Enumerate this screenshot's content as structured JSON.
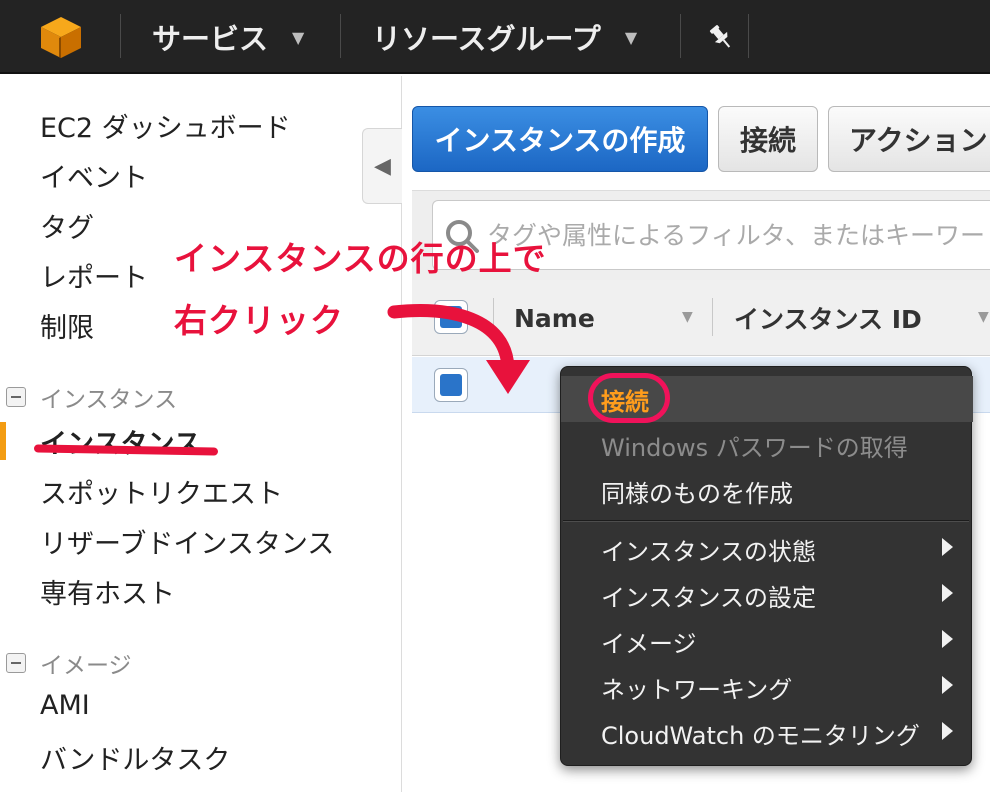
{
  "topbar": {
    "logo_icon": "aws-cube-icon",
    "services_label": "サービス",
    "resource_groups_label": "リソースグループ",
    "pin_icon": "pushpin-icon"
  },
  "sidebar": {
    "top_items": [
      {
        "label": "EC2 ダッシュボード"
      },
      {
        "label": "イベント"
      },
      {
        "label": "タグ"
      },
      {
        "label": "レポート"
      },
      {
        "label": "制限"
      }
    ],
    "sections": [
      {
        "title": "インスタンス",
        "items": [
          {
            "label": "インスタンス",
            "active": true
          },
          {
            "label": "スポットリクエスト"
          },
          {
            "label": "リザーブドインスタンス"
          },
          {
            "label": "専有ホスト"
          }
        ]
      },
      {
        "title": "イメージ",
        "items": [
          {
            "label": "AMI"
          },
          {
            "label": "バンドルタスク"
          }
        ]
      }
    ],
    "collapse_icon": "chevron-left-icon"
  },
  "toolbar": {
    "create_instance_label": "インスタンスの作成",
    "connect_label": "接続",
    "actions_label": "アクション"
  },
  "filter": {
    "placeholder": "タグや属性によるフィルタ、またはキーワードによる検索"
  },
  "table": {
    "columns": [
      "Name",
      "インスタンス ID"
    ]
  },
  "context_menu": {
    "items": [
      {
        "label": "接続",
        "highlighted": true
      },
      {
        "label": "Windows パスワードの取得",
        "disabled": true
      },
      {
        "label": "同様のものを作成"
      }
    ],
    "submenus": [
      {
        "label": "インスタンスの状態"
      },
      {
        "label": "インスタンスの設定"
      },
      {
        "label": "イメージ"
      },
      {
        "label": "ネットワーキング"
      },
      {
        "label": "CloudWatch のモニタリング"
      }
    ]
  },
  "annotation": {
    "line1": "インスタンスの行の上で",
    "line2": "右クリック",
    "color": "#e8123c"
  }
}
